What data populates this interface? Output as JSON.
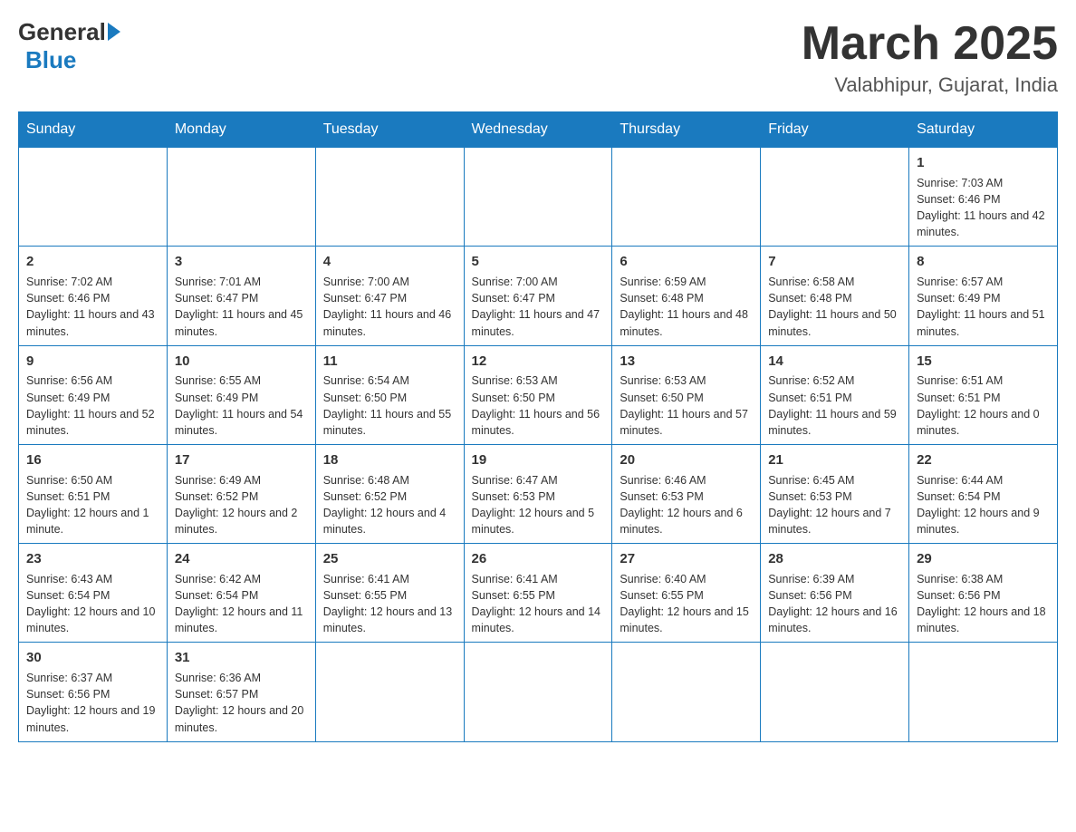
{
  "logo": {
    "general": "General",
    "blue": "Blue"
  },
  "title": {
    "month": "March 2025",
    "location": "Valabhipur, Gujarat, India"
  },
  "weekdays": [
    "Sunday",
    "Monday",
    "Tuesday",
    "Wednesday",
    "Thursday",
    "Friday",
    "Saturday"
  ],
  "weeks": [
    [
      {
        "day": "",
        "info": ""
      },
      {
        "day": "",
        "info": ""
      },
      {
        "day": "",
        "info": ""
      },
      {
        "day": "",
        "info": ""
      },
      {
        "day": "",
        "info": ""
      },
      {
        "day": "",
        "info": ""
      },
      {
        "day": "1",
        "info": "Sunrise: 7:03 AM\nSunset: 6:46 PM\nDaylight: 11 hours and 42 minutes."
      }
    ],
    [
      {
        "day": "2",
        "info": "Sunrise: 7:02 AM\nSunset: 6:46 PM\nDaylight: 11 hours and 43 minutes."
      },
      {
        "day": "3",
        "info": "Sunrise: 7:01 AM\nSunset: 6:47 PM\nDaylight: 11 hours and 45 minutes."
      },
      {
        "day": "4",
        "info": "Sunrise: 7:00 AM\nSunset: 6:47 PM\nDaylight: 11 hours and 46 minutes."
      },
      {
        "day": "5",
        "info": "Sunrise: 7:00 AM\nSunset: 6:47 PM\nDaylight: 11 hours and 47 minutes."
      },
      {
        "day": "6",
        "info": "Sunrise: 6:59 AM\nSunset: 6:48 PM\nDaylight: 11 hours and 48 minutes."
      },
      {
        "day": "7",
        "info": "Sunrise: 6:58 AM\nSunset: 6:48 PM\nDaylight: 11 hours and 50 minutes."
      },
      {
        "day": "8",
        "info": "Sunrise: 6:57 AM\nSunset: 6:49 PM\nDaylight: 11 hours and 51 minutes."
      }
    ],
    [
      {
        "day": "9",
        "info": "Sunrise: 6:56 AM\nSunset: 6:49 PM\nDaylight: 11 hours and 52 minutes."
      },
      {
        "day": "10",
        "info": "Sunrise: 6:55 AM\nSunset: 6:49 PM\nDaylight: 11 hours and 54 minutes."
      },
      {
        "day": "11",
        "info": "Sunrise: 6:54 AM\nSunset: 6:50 PM\nDaylight: 11 hours and 55 minutes."
      },
      {
        "day": "12",
        "info": "Sunrise: 6:53 AM\nSunset: 6:50 PM\nDaylight: 11 hours and 56 minutes."
      },
      {
        "day": "13",
        "info": "Sunrise: 6:53 AM\nSunset: 6:50 PM\nDaylight: 11 hours and 57 minutes."
      },
      {
        "day": "14",
        "info": "Sunrise: 6:52 AM\nSunset: 6:51 PM\nDaylight: 11 hours and 59 minutes."
      },
      {
        "day": "15",
        "info": "Sunrise: 6:51 AM\nSunset: 6:51 PM\nDaylight: 12 hours and 0 minutes."
      }
    ],
    [
      {
        "day": "16",
        "info": "Sunrise: 6:50 AM\nSunset: 6:51 PM\nDaylight: 12 hours and 1 minute."
      },
      {
        "day": "17",
        "info": "Sunrise: 6:49 AM\nSunset: 6:52 PM\nDaylight: 12 hours and 2 minutes."
      },
      {
        "day": "18",
        "info": "Sunrise: 6:48 AM\nSunset: 6:52 PM\nDaylight: 12 hours and 4 minutes."
      },
      {
        "day": "19",
        "info": "Sunrise: 6:47 AM\nSunset: 6:53 PM\nDaylight: 12 hours and 5 minutes."
      },
      {
        "day": "20",
        "info": "Sunrise: 6:46 AM\nSunset: 6:53 PM\nDaylight: 12 hours and 6 minutes."
      },
      {
        "day": "21",
        "info": "Sunrise: 6:45 AM\nSunset: 6:53 PM\nDaylight: 12 hours and 7 minutes."
      },
      {
        "day": "22",
        "info": "Sunrise: 6:44 AM\nSunset: 6:54 PM\nDaylight: 12 hours and 9 minutes."
      }
    ],
    [
      {
        "day": "23",
        "info": "Sunrise: 6:43 AM\nSunset: 6:54 PM\nDaylight: 12 hours and 10 minutes."
      },
      {
        "day": "24",
        "info": "Sunrise: 6:42 AM\nSunset: 6:54 PM\nDaylight: 12 hours and 11 minutes."
      },
      {
        "day": "25",
        "info": "Sunrise: 6:41 AM\nSunset: 6:55 PM\nDaylight: 12 hours and 13 minutes."
      },
      {
        "day": "26",
        "info": "Sunrise: 6:41 AM\nSunset: 6:55 PM\nDaylight: 12 hours and 14 minutes."
      },
      {
        "day": "27",
        "info": "Sunrise: 6:40 AM\nSunset: 6:55 PM\nDaylight: 12 hours and 15 minutes."
      },
      {
        "day": "28",
        "info": "Sunrise: 6:39 AM\nSunset: 6:56 PM\nDaylight: 12 hours and 16 minutes."
      },
      {
        "day": "29",
        "info": "Sunrise: 6:38 AM\nSunset: 6:56 PM\nDaylight: 12 hours and 18 minutes."
      }
    ],
    [
      {
        "day": "30",
        "info": "Sunrise: 6:37 AM\nSunset: 6:56 PM\nDaylight: 12 hours and 19 minutes."
      },
      {
        "day": "31",
        "info": "Sunrise: 6:36 AM\nSunset: 6:57 PM\nDaylight: 12 hours and 20 minutes."
      },
      {
        "day": "",
        "info": ""
      },
      {
        "day": "",
        "info": ""
      },
      {
        "day": "",
        "info": ""
      },
      {
        "day": "",
        "info": ""
      },
      {
        "day": "",
        "info": ""
      }
    ]
  ]
}
